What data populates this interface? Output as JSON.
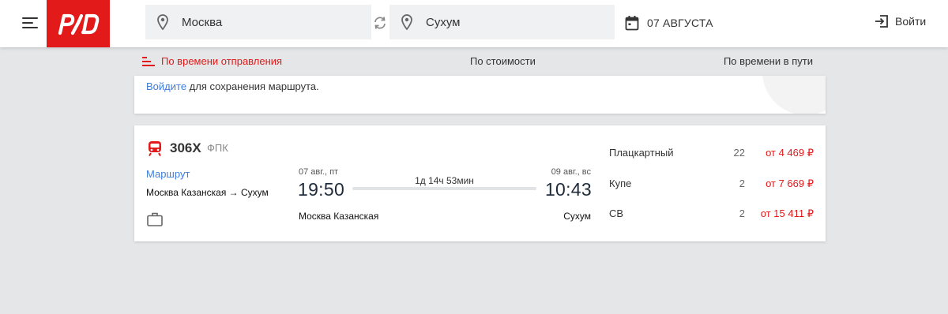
{
  "header": {
    "from": "Москва",
    "to": "Сухум",
    "date": "07 АВГУСТА",
    "login": "Войти",
    "logo_text": "РЖД"
  },
  "sort": {
    "by_departure": "По времени отправления",
    "by_price": "По стоимости",
    "by_duration": "По времени в пути"
  },
  "info": {
    "login_link": "Войдите",
    "text": " для сохранения маршрута."
  },
  "train": {
    "number": "306Х",
    "carrier": "ФПК",
    "route_link": "Маршрут",
    "route": "Москва Казанская → Сухум",
    "departure_date": "07 авг., пт",
    "departure_time": "19:50",
    "arrival_date": "09 авг., вс",
    "arrival_time": "10:43",
    "duration": "1д 14ч 53мин",
    "departure_station": "Москва Казанская",
    "arrival_station": "Сухум",
    "cars": [
      {
        "class": "Плацкартный",
        "seats": "22",
        "price": "от 4 469 ₽"
      },
      {
        "class": "Купе",
        "seats": "2",
        "price": "от 7 669 ₽"
      },
      {
        "class": "СВ",
        "seats": "2",
        "price": "от 15 411 ₽"
      }
    ]
  },
  "colors": {
    "brand": "#e21a1a",
    "link": "#3e7ddc",
    "background": "#e5e6e8"
  },
  "icons": [
    "menu-icon",
    "location-pin-icon",
    "swap-icon",
    "calendar-icon",
    "login-icon",
    "sort-icon",
    "train-icon",
    "luggage-icon"
  ]
}
